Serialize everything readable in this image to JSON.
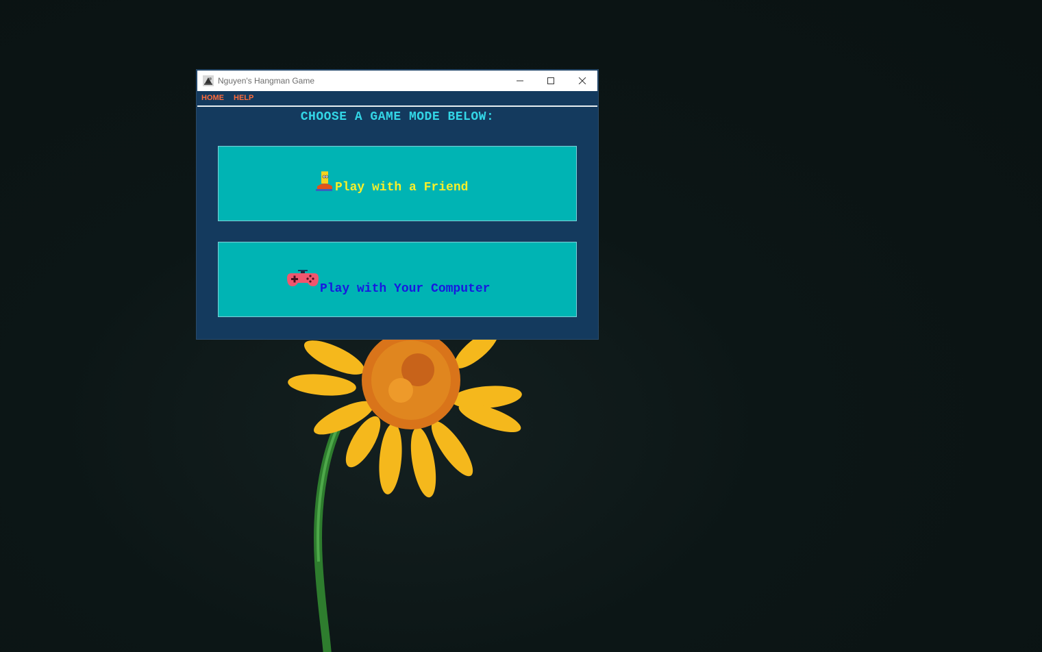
{
  "window": {
    "title": "Nguyen's Hangman Game"
  },
  "menu": {
    "items": [
      {
        "label": "HOME"
      },
      {
        "label": "HELP"
      }
    ]
  },
  "main": {
    "heading": "CHOOSE A GAME MODE BELOW:",
    "modes": [
      {
        "label": "Play with a Friend",
        "icon": "bart-icon"
      },
      {
        "label": "Play with Your Computer",
        "icon": "gamepad-icon"
      }
    ]
  },
  "colors": {
    "window_bg": "#143a5e",
    "button_bg": "#00b4b4",
    "heading": "#33d6e6",
    "menu_text": "#ff6b3a",
    "friend_label": "#f7ef2a",
    "computer_label": "#1818e0"
  }
}
